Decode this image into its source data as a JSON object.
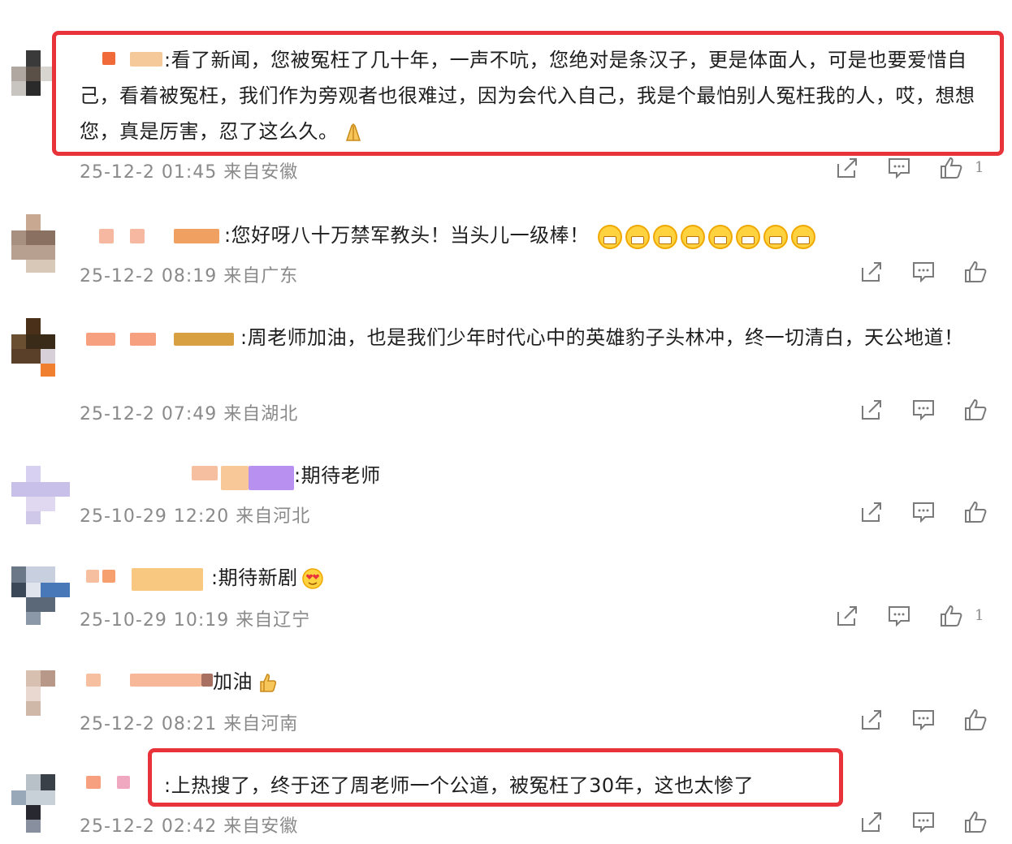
{
  "comments": [
    {
      "text": ":看了新闻，您被冤枉了几十年，一声不吭，您绝对是条汉子，更是体面人，可是也要爱惜自己，看着被冤枉，我们作为旁观者也很难过，因为会代入自己，我是个最怕别人冤枉我的人，哎，想想您，真是厉害，忍了这么久。",
      "time": "25-12-2 01:45",
      "location": "来自安徽",
      "likes": "1",
      "emoji": "folded-hands-emoji"
    },
    {
      "text": ":您好呀八十万禁军教头！当头儿一级棒！",
      "time": "25-12-2 08:19",
      "location": "来自广东",
      "likes": "",
      "emoji": "grin-emoji"
    },
    {
      "text": ":周老师加油，也是我们少年时代心中的英雄豹子头林冲，终一切清白，天公地道！",
      "time": "25-12-2 07:49",
      "location": "来自湖北",
      "likes": ""
    },
    {
      "text": ":期待老师",
      "time": "25-10-29 12:20",
      "location": "来自河北",
      "likes": ""
    },
    {
      "text": ":期待新剧",
      "time": "25-10-29 10:19",
      "location": "来自辽宁",
      "likes": "1",
      "emoji": "heart-eyes-emoji"
    },
    {
      "text": "加油",
      "time": "25-12-2 08:21",
      "location": "来自河南",
      "likes": "",
      "emoji": "thumbs-up-emoji"
    },
    {
      "text": ":上热搜了，终于还了周老师一个公道，被冤枉了30年，这也太惨了",
      "time": "25-12-2 02:42",
      "location": "来自安徽",
      "likes": ""
    }
  ],
  "colors": {
    "highlight": "#e8333a",
    "meta": "#8a8a8a",
    "icon": "#7a7a7a"
  },
  "icons": [
    "share-icon",
    "comment-icon",
    "like-icon"
  ]
}
